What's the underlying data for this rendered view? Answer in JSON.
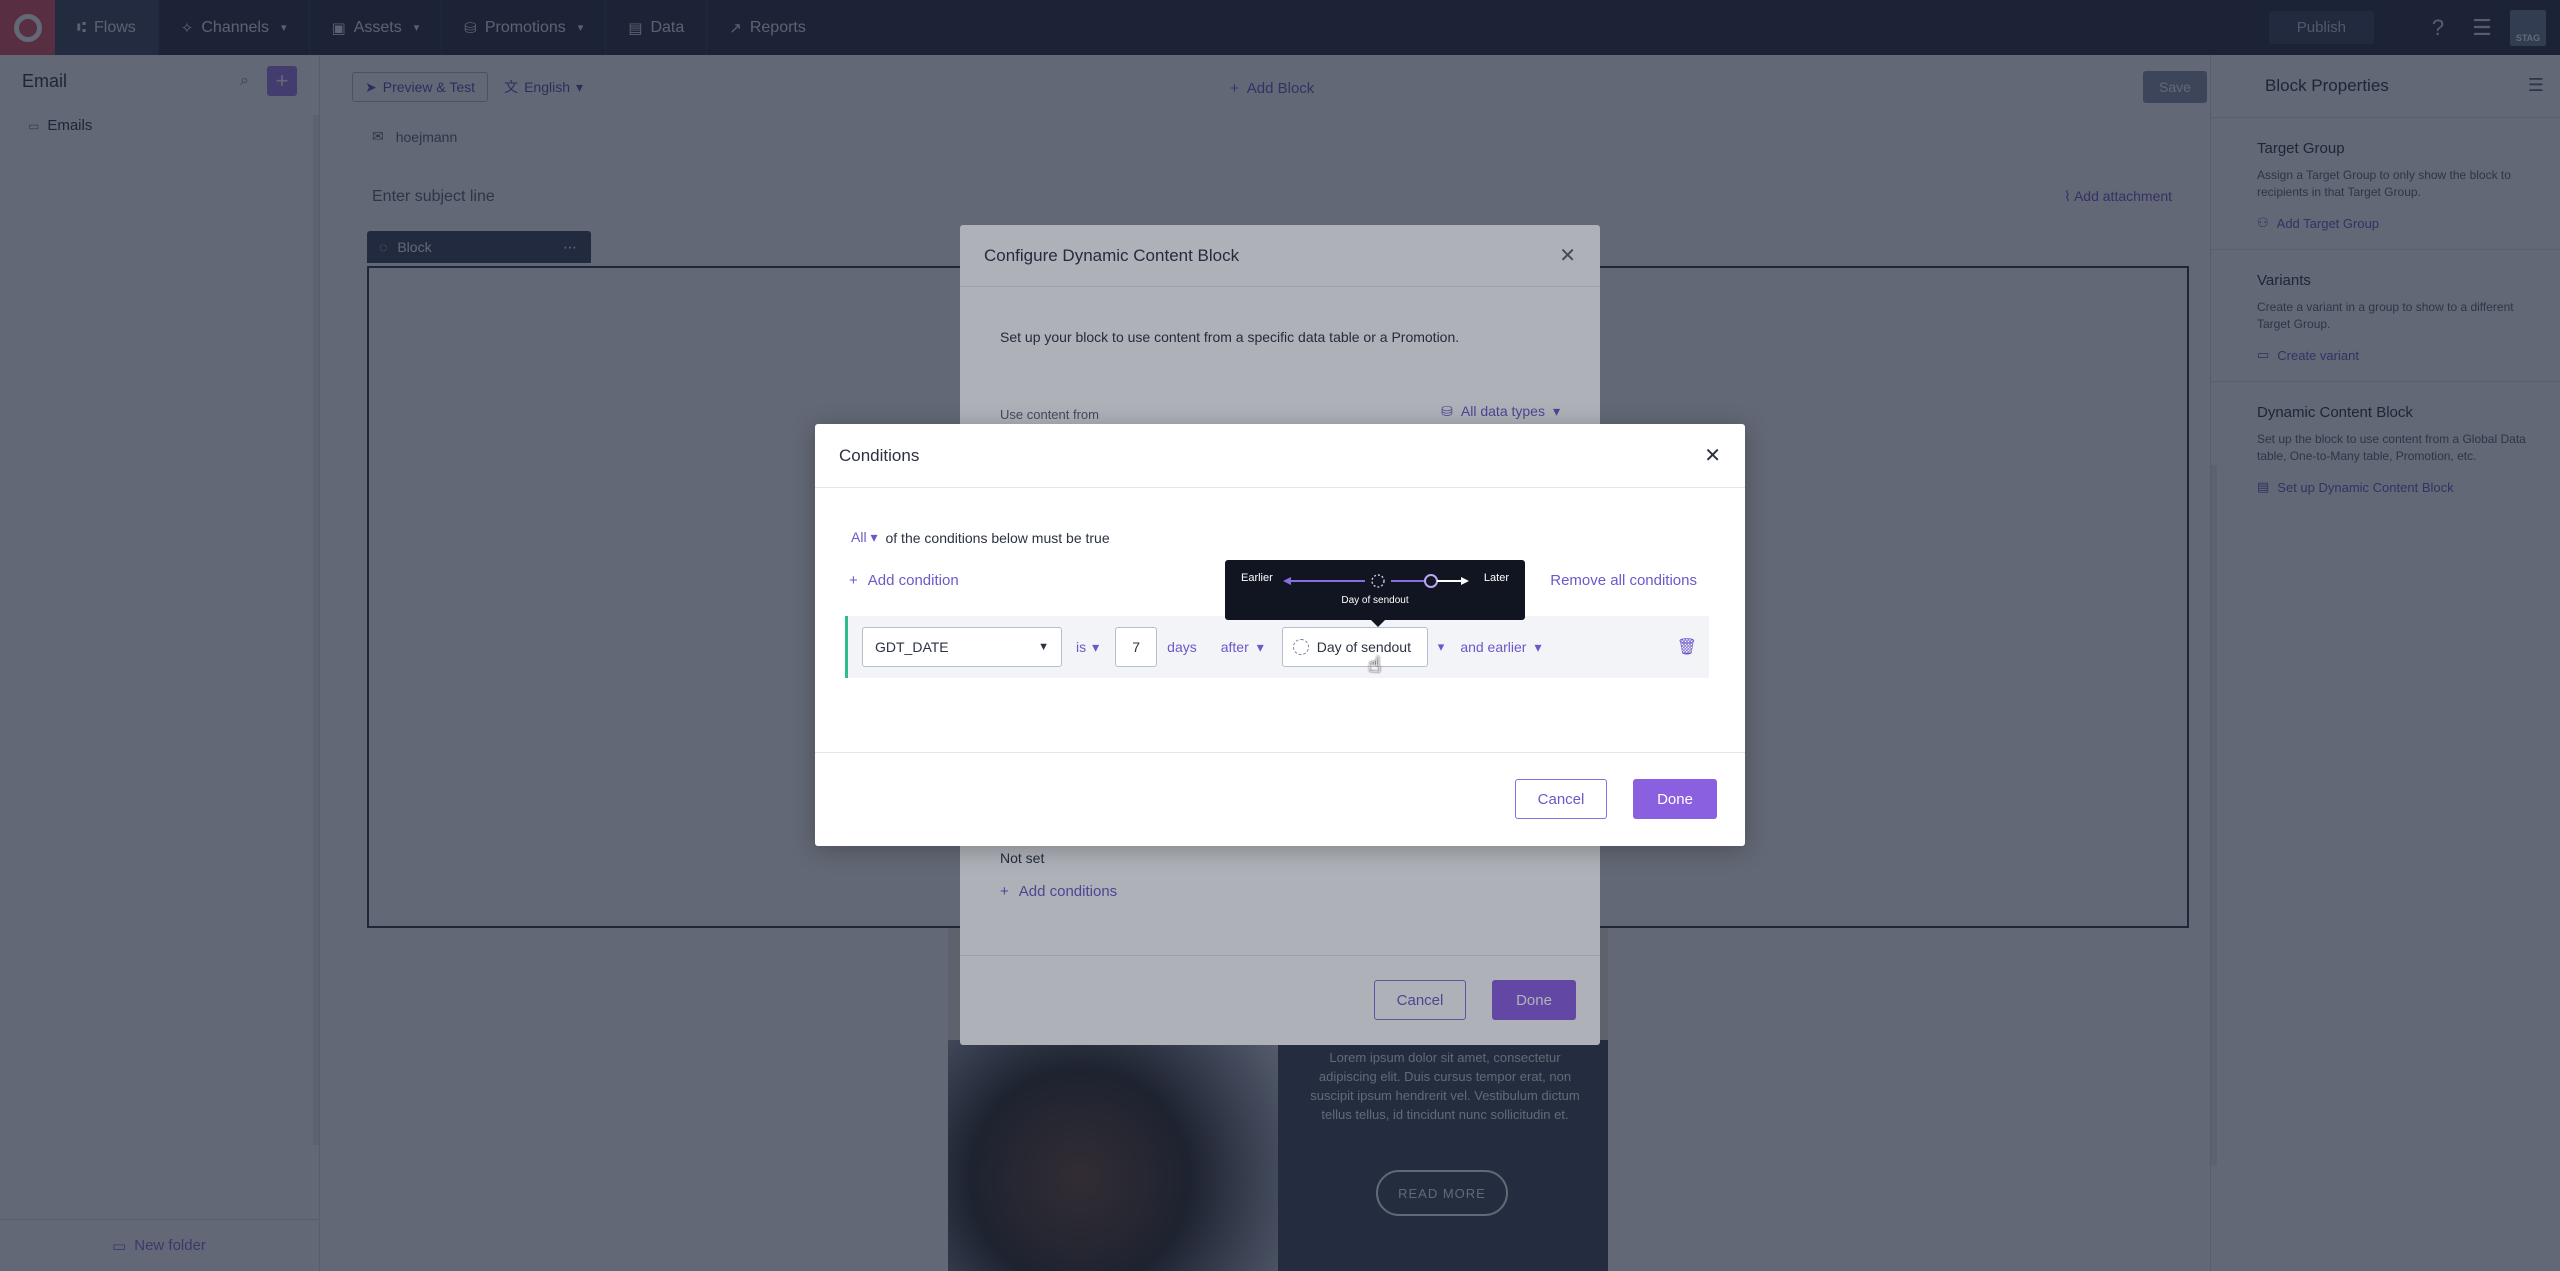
{
  "nav": {
    "items": [
      {
        "label": "Flows"
      },
      {
        "label": "Channels"
      },
      {
        "label": "Assets"
      },
      {
        "label": "Promotions"
      },
      {
        "label": "Data"
      },
      {
        "label": "Reports"
      }
    ],
    "publish": "Publish",
    "env_badge": "STAG"
  },
  "sidebar": {
    "title": "Email",
    "tree": [
      {
        "label": "Emails"
      }
    ],
    "new_folder": "New folder"
  },
  "editor": {
    "preview_test": "Preview & Test",
    "language": "English",
    "add_block": "Add Block",
    "save": "Save",
    "from": "hoejmann",
    "subject_placeholder": "Enter subject line",
    "add_attachment": "Add attachment",
    "block_label": "Block",
    "lorem": "Lorem ipsum dolor sit amet, consectetur adipiscing elit. Duis cursus tempor erat, non suscipit ipsum hendrerit vel. Vestibulum dictum tellus tellus, id tincidunt nunc sollicitudin et.",
    "read_more": "READ MORE"
  },
  "properties": {
    "title": "Block Properties",
    "sections": [
      {
        "title": "Target Group",
        "desc": "Assign a Target Group to only show the block to recipients in that Target Group.",
        "link": "Add Target Group"
      },
      {
        "title": "Variants",
        "desc": "Create a variant in a group to show to a different Target Group.",
        "link": "Create variant"
      },
      {
        "title": "Dynamic Content Block",
        "desc": "Set up the block to use content from a Global Data table, One-to-Many table, Promotion, etc.",
        "link": "Set up Dynamic Content Block"
      }
    ]
  },
  "configure": {
    "title": "Configure Dynamic Content Block",
    "description": "Set up your block to use content from a specific data table or a Promotion.",
    "use_from": "Use content from",
    "data_types": "All data types",
    "not_set": "Not set",
    "add_conditions": "Add conditions",
    "cancel": "Cancel",
    "done": "Done"
  },
  "conditions": {
    "title": "Conditions",
    "quantifier": "All",
    "quantifier_suffix": "of the conditions below must be true",
    "add_condition": "Add condition",
    "remove_all": "Remove all conditions",
    "row": {
      "field": "GDT_DATE",
      "operator": "is",
      "amount": "7",
      "unit": "days",
      "direction": "after",
      "anchor": "Day of sendout",
      "range": "and earlier"
    },
    "cancel": "Cancel",
    "done": "Done"
  },
  "tooltip": {
    "earlier": "Earlier",
    "later": "Later",
    "label": "Day of sendout"
  }
}
